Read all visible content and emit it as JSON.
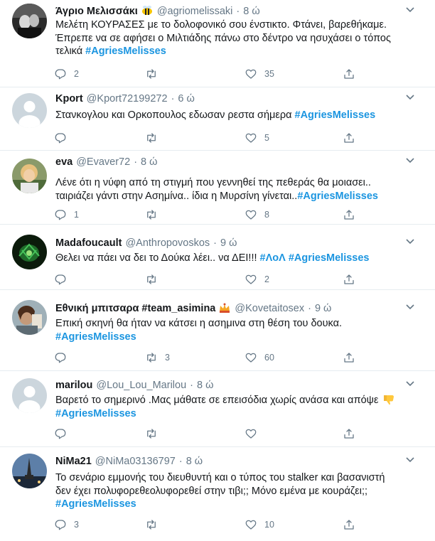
{
  "tweets": [
    {
      "name": "Άγριο Μελισσάκι",
      "handle": "@agriomelissaki",
      "time": "8 ώ",
      "lines": [
        {
          "text": "Μελέτη ΚΟΥΡΑΣΕΣ με το δολοφονικό σου ένστικτο. Φτάνει, βαρεθήκαμε.",
          "hashtag": ""
        },
        {
          "text": "Έπρεπε να σε αφήσει ο Μιλτιάδης πάνω στο δέντρο να ησυχάσει ο τόπος",
          "hashtag": ""
        },
        {
          "text": "τελικά ",
          "hashtag": "#AgriesMelisses"
        }
      ],
      "reply_count": "2",
      "retweet_count": "",
      "like_count": "35",
      "name_emoji": "bee-emoji"
    },
    {
      "name": "Kport",
      "handle": "@Kport72199272",
      "time": "6 ώ",
      "lines": [
        {
          "text": "Στανκογλου και Ορκοπουλος εδωσαν ρεστα σήμερα ",
          "hashtag": "#AgriesMelisses"
        }
      ],
      "reply_count": "",
      "retweet_count": "",
      "like_count": "5"
    },
    {
      "name": "eva",
      "handle": "@Evaver72",
      "time": "8 ώ",
      "lines": [
        {
          "text": "Λένε ότι η νύφη από τη στιγμή που γεννηθεί της πεθεράς θα μοιασει..",
          "hashtag": ""
        },
        {
          "text": "ταιριάζει γάντι στην Ασημίνα.. ίδια η Μυρσίνη γίνεται..",
          "hashtag": "#AgriesMelisses"
        }
      ],
      "reply_count": "1",
      "retweet_count": "",
      "like_count": "8"
    },
    {
      "name": "Madafoucault",
      "handle": "@Anthropovoskos",
      "time": "9 ώ",
      "lines": [
        {
          "text": "Θελει να πάει να δει το Δούκα λέει.. να ΔΕΙ!!! ",
          "hashtag": "#ΛοΛ #AgriesMelisses"
        }
      ],
      "reply_count": "",
      "retweet_count": "",
      "like_count": "2"
    },
    {
      "name": "Εθνική μπιτσαρα #team_asimina",
      "handle": "@Kovetaitosex",
      "time": "9 ώ",
      "lines": [
        {
          "text": "Επική σκηνή θα ήταν να κάτσει η ασημινα στη θέση του δουκα.",
          "hashtag": ""
        },
        {
          "text": "",
          "hashtag": "#AgriesMelisses"
        }
      ],
      "reply_count": "",
      "retweet_count": "3",
      "like_count": "60",
      "name_emoji": "crown-emoji"
    },
    {
      "name": "marilou",
      "handle": "@Lou_Lou_Marilou",
      "time": "8 ώ",
      "lines": [
        {
          "text": "Βαρετό το σημερινό .Μας μάθατε σε επεισόδια χωρίς ανάσα και απόψε",
          "hashtag": ""
        },
        {
          "text": "",
          "hashtag": "#AgriesMelisses"
        }
      ],
      "reply_count": "",
      "retweet_count": "",
      "like_count": "",
      "text_emoji": "thumbs-down-emoji"
    },
    {
      "name": "NiMa21",
      "handle": "@NiMa03136797",
      "time": "8 ώ",
      "lines": [
        {
          "text": "Το σενάριο εμμονής του διευθυντή και ο τύπος του stalker και βασανιστή",
          "hashtag": ""
        },
        {
          "text": "δεν έχει πολυφορεθεολυφορεθεί στην τιβι;; Μόνο εμένα με κουράζει;;",
          "hashtag": ""
        },
        {
          "text": "",
          "hashtag": "#AgriesMelisses"
        }
      ],
      "reply_count": "3",
      "retweet_count": "",
      "like_count": "10"
    }
  ],
  "colors": {
    "text": "#14171a",
    "secondary": "#657786",
    "hashtag": "#1b95e0",
    "divider": "#e6ecf0"
  },
  "icons": [
    "reply-icon",
    "retweet-icon",
    "like-icon",
    "share-icon",
    "caret-down-icon"
  ]
}
